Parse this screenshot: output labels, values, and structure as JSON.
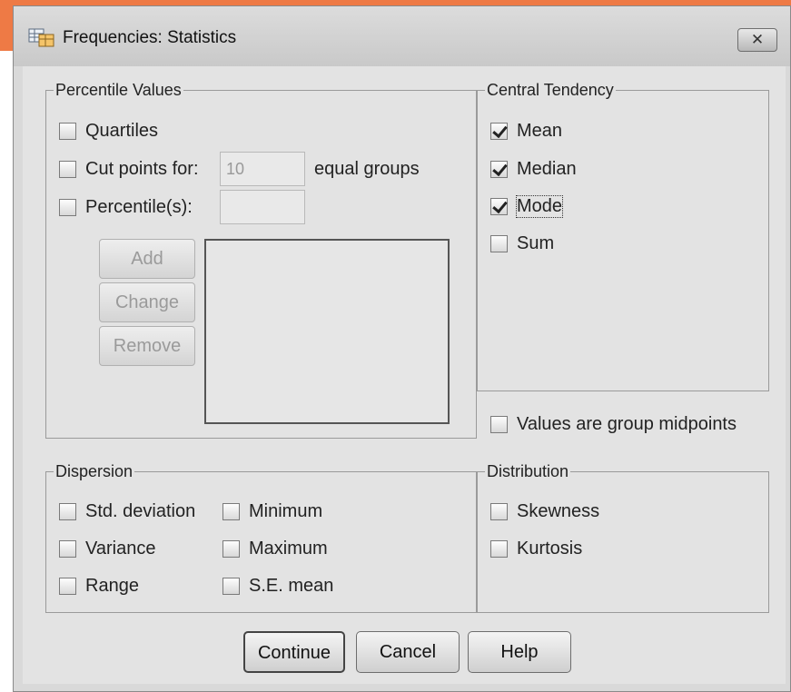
{
  "window": {
    "title": "Frequencies: Statistics",
    "close_label": "✕"
  },
  "percentile_values": {
    "legend": "Percentile Values",
    "quartiles": {
      "label": "Quartiles",
      "checked": false
    },
    "cut_points": {
      "label": "Cut points for:",
      "value": "10",
      "suffix": "equal groups",
      "checked": false
    },
    "percentiles": {
      "label": "Percentile(s):",
      "value": "",
      "checked": false
    },
    "add_label": "Add",
    "change_label": "Change",
    "remove_label": "Remove"
  },
  "central_tendency": {
    "legend": "Central Tendency",
    "items": [
      {
        "label": "Mean",
        "checked": true
      },
      {
        "label": "Median",
        "checked": true
      },
      {
        "label": "Mode",
        "checked": true
      },
      {
        "label": "Sum",
        "checked": false
      }
    ]
  },
  "group_midpoints": {
    "label": "Values are group midpoints",
    "checked": false
  },
  "dispersion": {
    "legend": "Dispersion",
    "items": [
      {
        "label": "Std. deviation",
        "checked": false
      },
      {
        "label": "Minimum",
        "checked": false
      },
      {
        "label": "Variance",
        "checked": false
      },
      {
        "label": "Maximum",
        "checked": false
      },
      {
        "label": "Range",
        "checked": false
      },
      {
        "label": "S.E. mean",
        "checked": false
      }
    ]
  },
  "distribution": {
    "legend": "Distribution",
    "items": [
      {
        "label": "Skewness",
        "checked": false
      },
      {
        "label": "Kurtosis",
        "checked": false
      }
    ]
  },
  "buttons": {
    "continue": "Continue",
    "cancel": "Cancel",
    "help": "Help"
  },
  "colors": {
    "accent": "#ee7a45",
    "dialog_bg": "#e3e3e3"
  }
}
